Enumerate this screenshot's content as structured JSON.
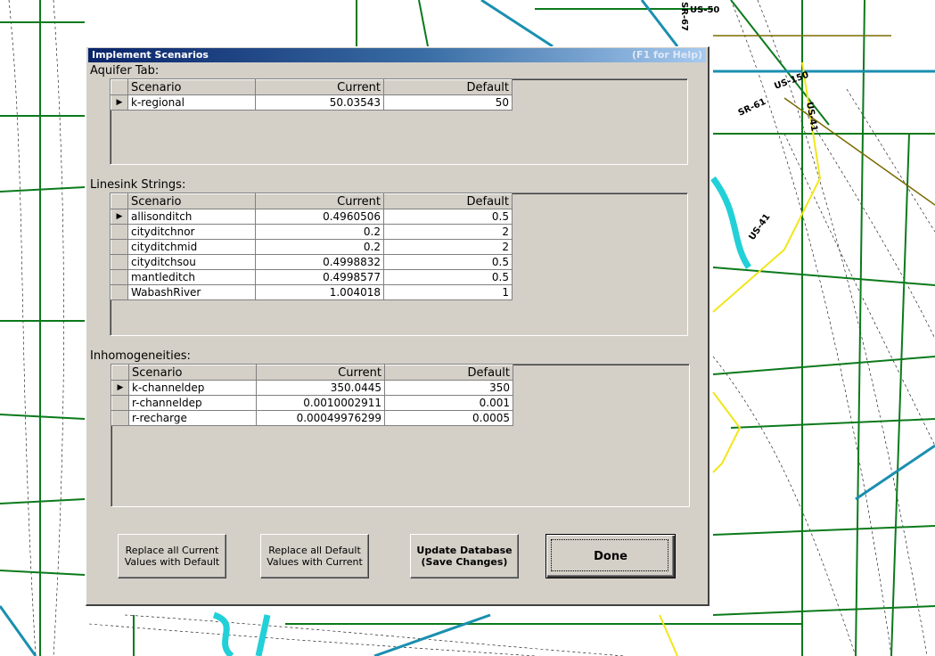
{
  "map": {
    "labels": [
      "US-50",
      "SR-61",
      "US-150",
      "US-41",
      "US-41",
      "SR-67"
    ]
  },
  "dialog": {
    "title": "Implement Scenarios",
    "help": "(F1 for Help)",
    "aquifer": {
      "label": "Aquifer Tab:",
      "columns": [
        "Scenario",
        "Current",
        "Default"
      ],
      "rows": [
        {
          "scenario": "k-regional",
          "current": "50.03543",
          "default": "50",
          "selected": true
        }
      ]
    },
    "linesink": {
      "label": "Linesink Strings:",
      "columns": [
        "Scenario",
        "Current",
        "Default"
      ],
      "rows": [
        {
          "scenario": "allisonditch",
          "current": "0.4960506",
          "default": "0.5",
          "selected": true
        },
        {
          "scenario": "cityditchnor",
          "current": "0.2",
          "default": "2"
        },
        {
          "scenario": "cityditchmid",
          "current": "0.2",
          "default": "2"
        },
        {
          "scenario": "cityditchsou",
          "current": "0.4998832",
          "default": "0.5"
        },
        {
          "scenario": "mantleditch",
          "current": "0.4998577",
          "default": "0.5"
        },
        {
          "scenario": "WabashRiver",
          "current": "1.004018",
          "default": "1"
        }
      ]
    },
    "inhomogeneities": {
      "label": "Inhomogeneities:",
      "columns": [
        "Scenario",
        "Current",
        "Default"
      ],
      "rows": [
        {
          "scenario": "k-channeldep",
          "current": "350.0445",
          "default": "350",
          "selected": true
        },
        {
          "scenario": "r-channeldep",
          "current": "0.0010002911",
          "default": "0.001"
        },
        {
          "scenario": "r-recharge",
          "current": "0.00049976299",
          "default": "0.0005"
        }
      ]
    },
    "buttons": {
      "replace_current_line1": "Replace all Current",
      "replace_current_line2": "Values with Default",
      "replace_default_line1": "Replace all Default",
      "replace_default_line2": "Values with Current",
      "update_line1": "Update Database",
      "update_line2": "(Save Changes)",
      "done": "Done"
    }
  }
}
